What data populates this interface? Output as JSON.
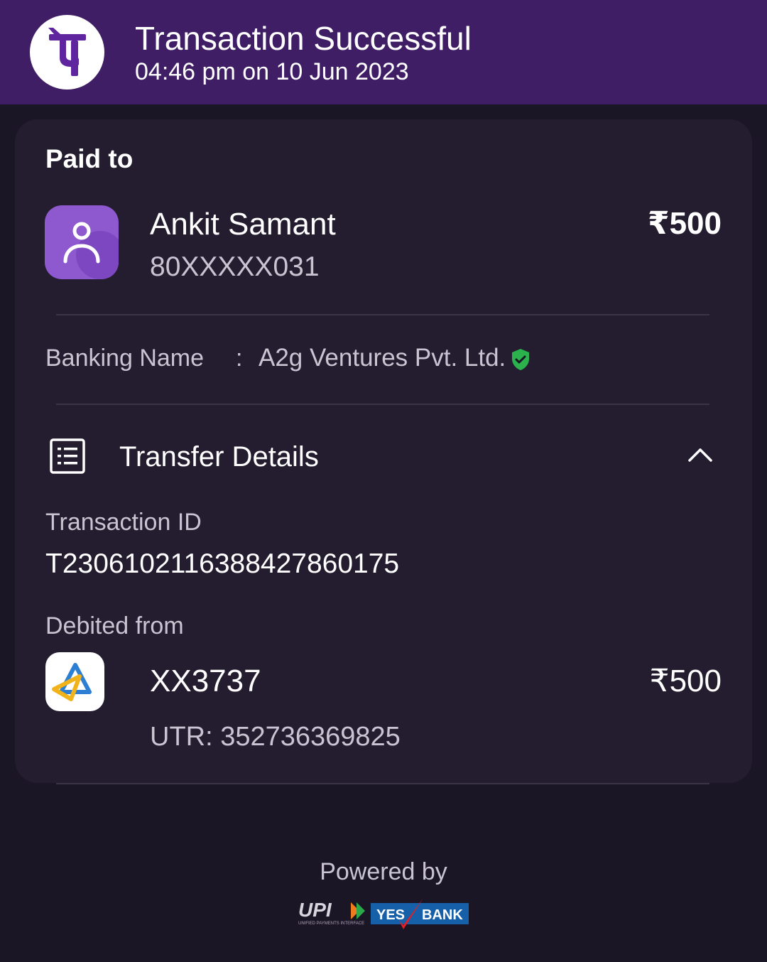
{
  "header": {
    "app_logo_icon": "phonepe-logo-icon",
    "title": "Transaction Successful",
    "timestamp": "04:46 pm on 10 Jun 2023",
    "background_color": "#3f1e66"
  },
  "paid_to": {
    "label": "Paid to",
    "avatar_icon": "user-avatar-icon",
    "name": "Ankit Samant",
    "phone": "80XXXXX031",
    "amount": "₹500"
  },
  "banking": {
    "label": "Banking Name",
    "separator": ":",
    "value": "A2g Ventures Pvt. Ltd.",
    "verified_icon": "verified-shield-icon",
    "verified_color": "#2bb24c"
  },
  "transfer_details": {
    "icon": "receipt-list-icon",
    "title": "Transfer Details",
    "toggle_icon": "chevron-up-icon",
    "transaction_id_label": "Transaction ID",
    "transaction_id": "T2306102116388427860175",
    "debited_from_label": "Debited from",
    "bank_icon": "state-bank-logo-icon",
    "account": "XX3737",
    "amount": "₹500",
    "utr": "UTR: 352736369825"
  },
  "footer": {
    "powered_by": "Powered by",
    "upi_logo_icon": "upi-logo",
    "upi_text": "UPI",
    "upi_subtext": "UNIFIED PAYMENTS INTERFACE",
    "bank_partner_icon": "yes-bank-logo",
    "yes_text": "YES",
    "bank_text": "BANK"
  }
}
